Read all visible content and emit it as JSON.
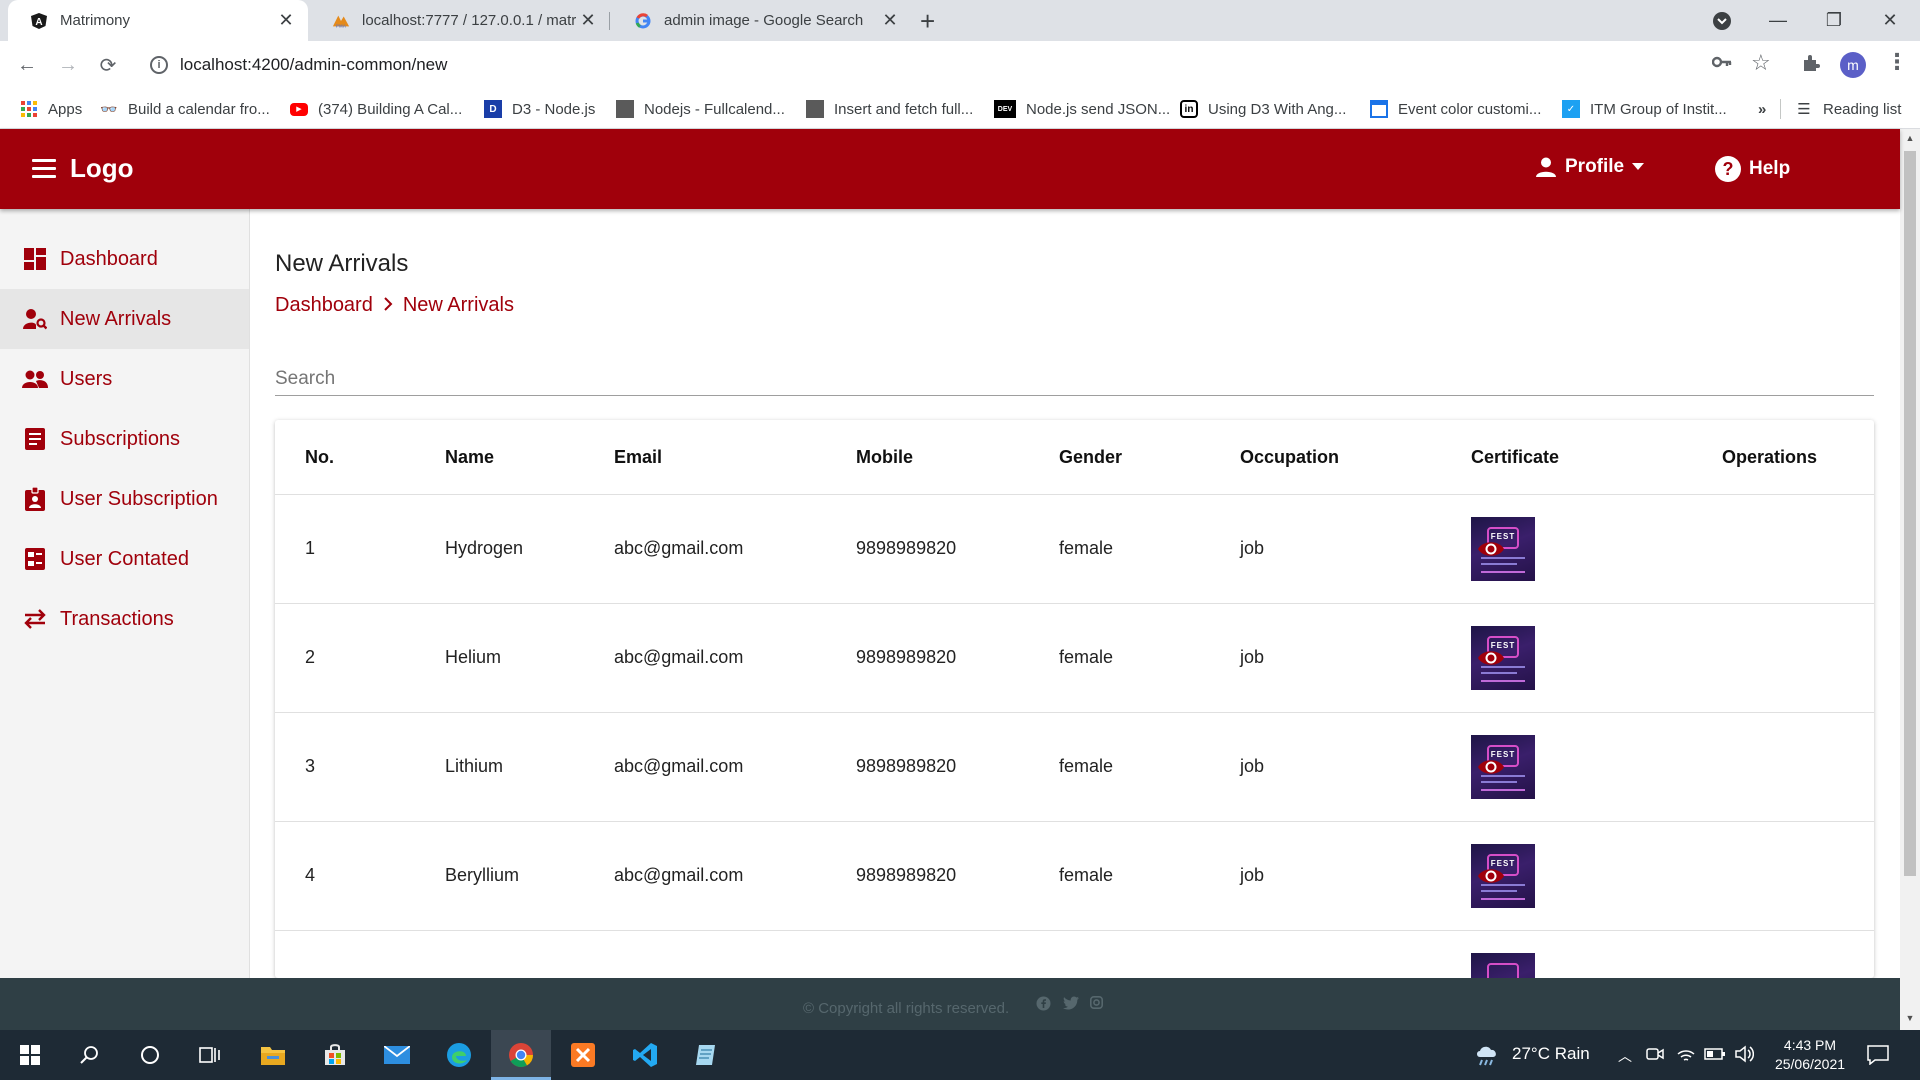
{
  "browser": {
    "tabs": [
      {
        "title": "Matrimony",
        "active": true
      },
      {
        "title": "localhost:7777 / 127.0.0.1 / matri",
        "active": false
      },
      {
        "title": "admin image - Google Search",
        "active": false
      }
    ],
    "url": "localhost:4200/admin-common/new",
    "profile_initial": "m",
    "bookmarks": [
      "Apps",
      "Build a calendar fro...",
      "(374) Building A Cal...",
      "D3 - Node.js",
      "Nodejs - Fullcalend...",
      "Insert and fetch full...",
      "Node.js send JSON...",
      "Using D3 With Ang...",
      "Event color customi...",
      "ITM Group of Instit..."
    ],
    "bookmarks_overflow": "»",
    "reading_list": "Reading list"
  },
  "header": {
    "logo": "Logo",
    "profile_label": "Profile",
    "help_label": "Help",
    "accent_color": "#a0000b"
  },
  "sidebar": {
    "items": [
      {
        "label": "Dashboard",
        "icon": "dashboard-icon",
        "active": false
      },
      {
        "label": "New Arrivals",
        "icon": "person-search-icon",
        "active": true
      },
      {
        "label": "Users",
        "icon": "users-icon",
        "active": false
      },
      {
        "label": "Subscriptions",
        "icon": "subscriptions-icon",
        "active": false
      },
      {
        "label": "User Subscription",
        "icon": "badge-icon",
        "active": false
      },
      {
        "label": "User Contated",
        "icon": "contacts-icon",
        "active": false
      },
      {
        "label": "Transactions",
        "icon": "swap-arrows-icon",
        "active": false
      }
    ]
  },
  "main": {
    "title": "New Arrivals",
    "breadcrumb": [
      "Dashboard",
      "New Arrivals"
    ],
    "search_placeholder": "Search",
    "columns": [
      "No.",
      "Name",
      "Email",
      "Mobile",
      "Gender",
      "Occupation",
      "Certificate",
      "Operations"
    ],
    "rows": [
      {
        "no": "1",
        "name": "Hydrogen",
        "email": "abc@gmail.com",
        "mobile": "9898989820",
        "gender": "female",
        "occupation": "job"
      },
      {
        "no": "2",
        "name": "Helium",
        "email": "abc@gmail.com",
        "mobile": "9898989820",
        "gender": "female",
        "occupation": "job"
      },
      {
        "no": "3",
        "name": "Lithium",
        "email": "abc@gmail.com",
        "mobile": "9898989820",
        "gender": "female",
        "occupation": "job"
      },
      {
        "no": "4",
        "name": "Beryllium",
        "email": "abc@gmail.com",
        "mobile": "9898989820",
        "gender": "female",
        "occupation": "job"
      }
    ],
    "certificate_text": "FEST"
  },
  "footer": {
    "copyright": "© Copyright all rights reserved.",
    "social_icons": [
      "facebook-icon",
      "twitter-icon",
      "instagram-icon"
    ]
  },
  "taskbar": {
    "weather": "27°C  Rain",
    "time": "4:43 PM",
    "date": "25/06/2021"
  }
}
